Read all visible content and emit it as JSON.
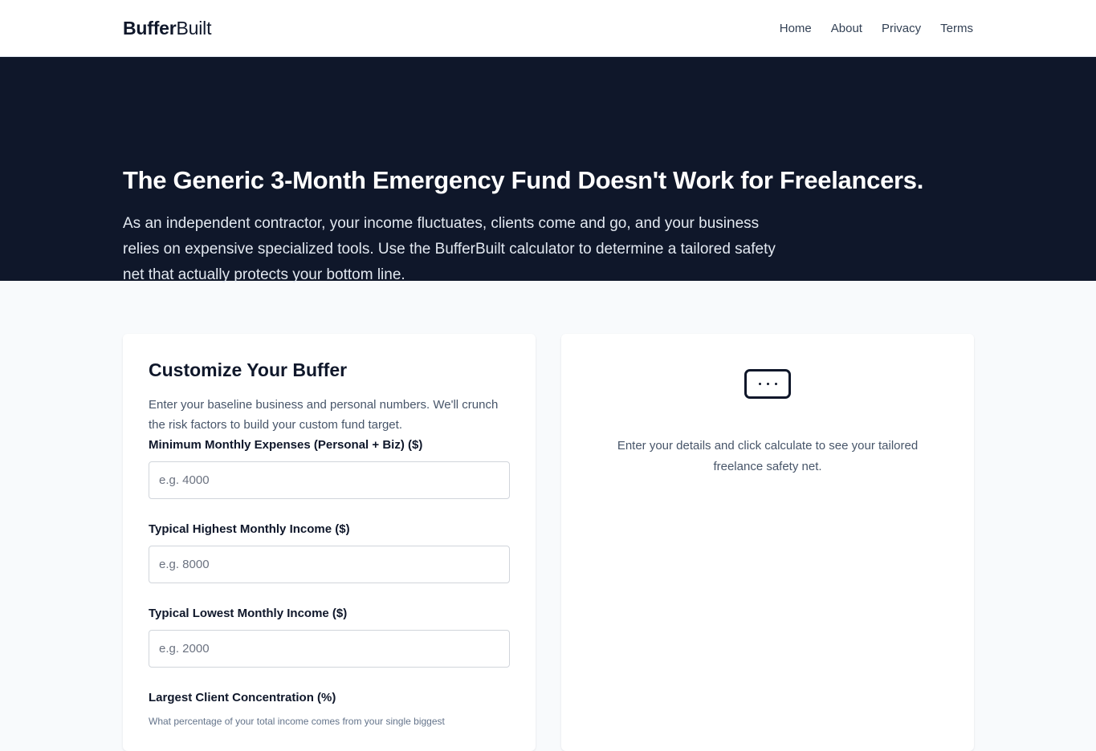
{
  "header": {
    "brand_bold": "Buffer",
    "brand_regular": "Built",
    "nav": [
      "Home",
      "About",
      "Privacy",
      "Terms"
    ]
  },
  "hero": {
    "title": "The Generic 3-Month Emergency Fund Doesn't Work for Freelancers.",
    "subtitle": "As an independent contractor, your income fluctuates, clients come and go, and your business relies on expensive specialized tools. Use the BufferBuilt calculator to determine a tailored safety net that actually protects your bottom line."
  },
  "form": {
    "title": "Customize Your Buffer",
    "intro": "Enter your baseline business and personal numbers. We'll crunch the risk factors to build your custom fund target.",
    "fields": [
      {
        "label": "Minimum Monthly Expenses (Personal + Biz) ($)",
        "placeholder": "e.g. 4000",
        "value": ""
      },
      {
        "label": "Typical Highest Monthly Income ($)",
        "placeholder": "e.g. 8000",
        "value": ""
      },
      {
        "label": "Typical Lowest Monthly Income ($)",
        "placeholder": "e.g. 2000",
        "value": ""
      },
      {
        "label": "Largest Client Concentration (%)",
        "help": "What percentage of your total income comes from your single biggest"
      }
    ]
  },
  "result": {
    "icon": "ellipsis-box-icon",
    "message": "Enter your details and click calculate to see your tailored freelance safety net."
  },
  "colors": {
    "dark": "#0f172a",
    "page_bg": "#f8fafc",
    "card_bg": "#ffffff",
    "muted_text": "#475569"
  }
}
